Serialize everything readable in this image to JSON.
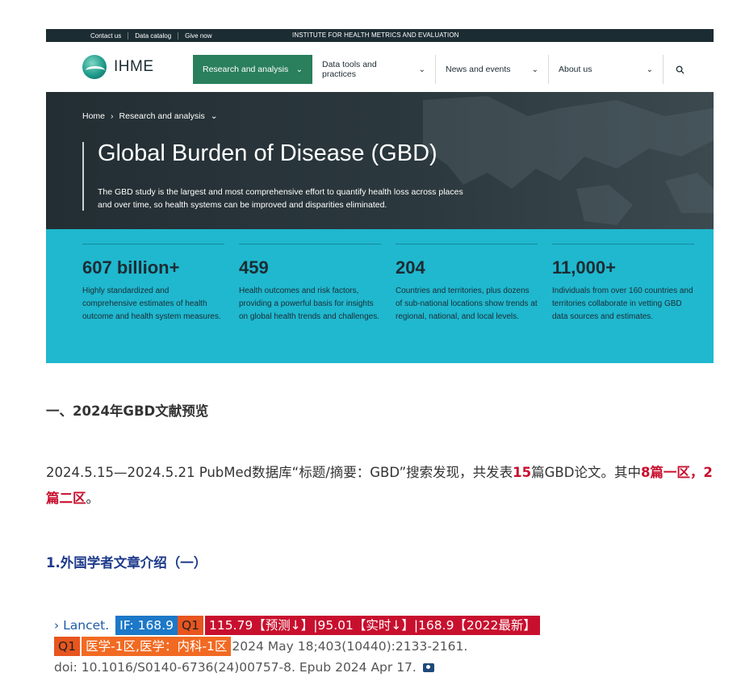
{
  "ihme": {
    "utility_links": [
      "Contact us",
      "Data catalog",
      "Give now"
    ],
    "institute": "INSTITUTE FOR HEALTH METRICS AND EVALUATION",
    "logo_text": "IHME",
    "nav": [
      {
        "label": "Research and analysis",
        "active": true
      },
      {
        "label": "Data tools and practices",
        "active": false
      },
      {
        "label": "News and events",
        "active": false
      },
      {
        "label": "About us",
        "active": false
      }
    ],
    "breadcrumb": {
      "home": "Home",
      "current": "Research and analysis"
    },
    "hero_title": "Global Burden of Disease (GBD)",
    "hero_desc": "The GBD study is the largest and most comprehensive effort to quantify health loss across places and over time, so health systems can be improved and disparities eliminated.",
    "stats": [
      {
        "num": "607 billion+",
        "desc": "Highly standardized and comprehensive estimates of health outcome and health system measures."
      },
      {
        "num": "459",
        "desc": "Health outcomes and risk factors, providing a powerful basis for insights on global health trends and challenges."
      },
      {
        "num": "204",
        "desc": "Countries and territories, plus dozens of sub-national locations show trends at regional, national, and local levels."
      },
      {
        "num": "11,000+",
        "desc": "Individuals from over 160 countries and territories collaborate in vetting GBD data sources and estimates."
      }
    ],
    "colors": {
      "topbar": "#1c2c33",
      "active_nav": "#2a7f5c",
      "stats_bg": "#1fb8cf"
    }
  },
  "article": {
    "section_title": "一、2024年GBD文献预览",
    "para_a": "2024.5.15—2024.5.21 PubMed数据库“标题/摘要：GBD”搜索发现，共发表",
    "para_count": "15",
    "para_b": "篇GBD论文。其中",
    "para_q1": "8篇一区，2篇二区",
    "para_end": "。",
    "sub_title": "1.外国学者文章介绍（一）"
  },
  "citation": {
    "journal": "› Lancet.",
    "if_badge": "IF: 168.9",
    "q1_badge": "Q1",
    "trend_badge": "115.79【预测↓】|95.01【实时↓】|168.9【2022最新】",
    "q1_badge2": "Q1",
    "category_badge": "医学-1区,医学：内科-1区",
    "ref": "2024 May 18;403(10440):2133-2161.",
    "doi": "doi: 10.1016/S0140-6736(24)00757-8. Epub 2024 Apr 17.",
    "camera_icon": "camera-icon"
  }
}
